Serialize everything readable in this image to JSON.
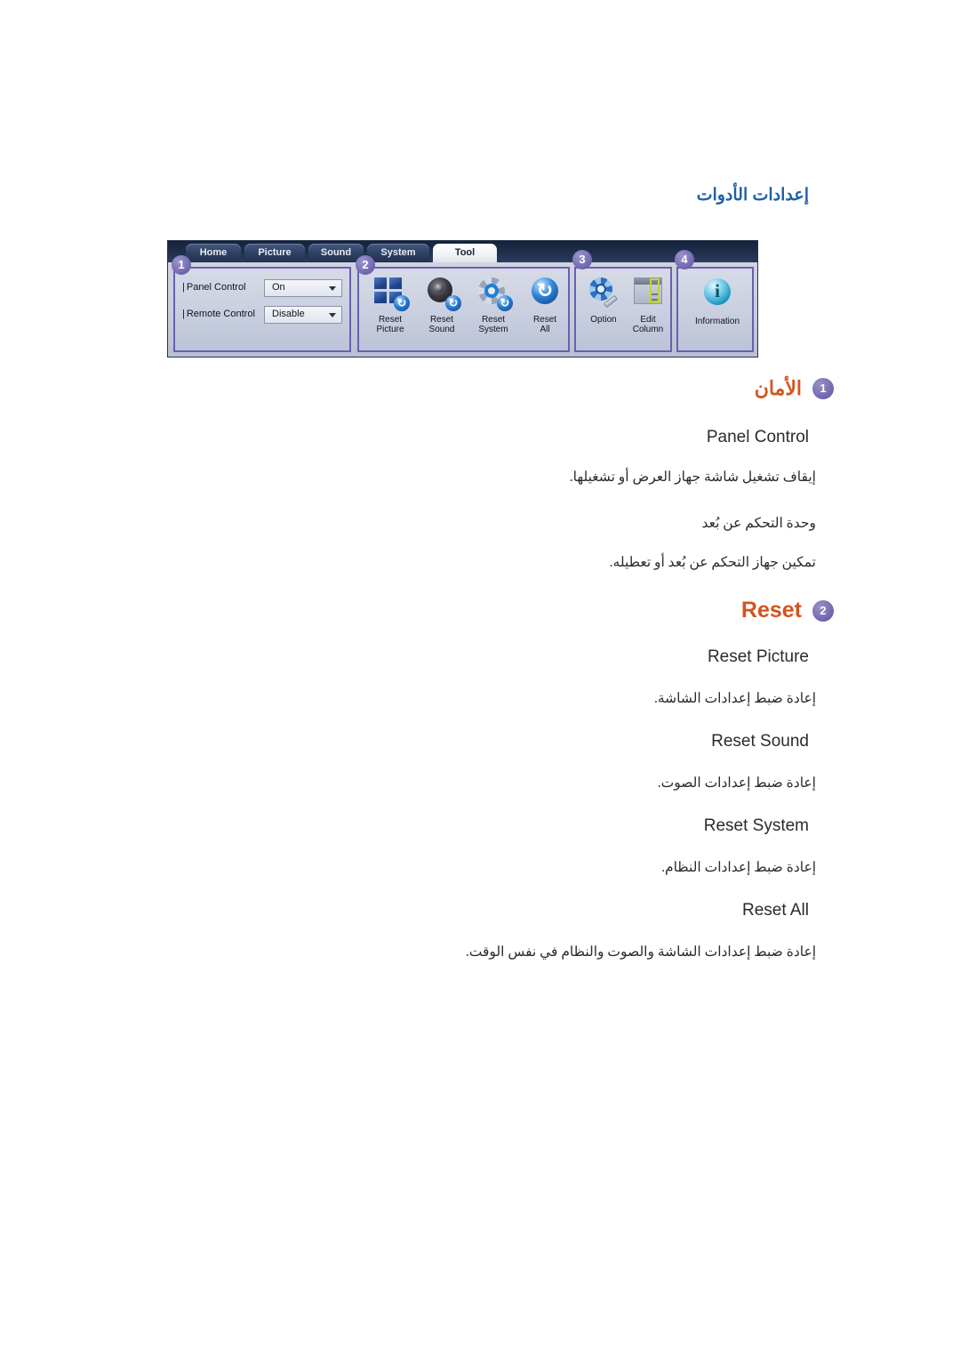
{
  "page": {
    "title": "إعدادات الأدوات"
  },
  "toolbar": {
    "tabs": [
      {
        "label": "Home",
        "active": false
      },
      {
        "label": "Picture",
        "active": false
      },
      {
        "label": "Sound",
        "active": false
      },
      {
        "label": "System",
        "active": false
      },
      {
        "label": "Tool",
        "active": true
      }
    ],
    "group1": {
      "badge": "1",
      "rows": [
        {
          "label": "Panel Control",
          "value": "On"
        },
        {
          "label": "Remote Control",
          "value": "Disable"
        }
      ]
    },
    "group2": {
      "badge": "2",
      "icons": [
        {
          "caption_line1": "Reset",
          "caption_line2": "Picture"
        },
        {
          "caption_line1": "Reset",
          "caption_line2": "Sound"
        },
        {
          "caption_line1": "Reset",
          "caption_line2": "System"
        },
        {
          "caption_line1": "Reset",
          "caption_line2": "All"
        }
      ]
    },
    "group3": {
      "badge": "3",
      "icons": [
        {
          "caption_line1": "Option",
          "caption_line2": ""
        },
        {
          "caption_line1": "Edit",
          "caption_line2": "Column"
        }
      ]
    },
    "group4": {
      "badge": "4",
      "icons": [
        {
          "caption_line1": "Information",
          "caption_line2": ""
        }
      ]
    }
  },
  "sections": [
    {
      "badge": "1",
      "heading": "الأمان",
      "items": [
        {
          "name": "Panel Control",
          "description": "إيقاف تشغيل شاشة جهاز العرض أو تشغيلها."
        },
        {
          "name": "وحدة التحكم عن بُعد",
          "description": "تمكين جهاز التحكم عن بُعد أو تعطيله."
        }
      ]
    },
    {
      "badge": "2",
      "heading": "Reset",
      "items": [
        {
          "name": "Reset Picture",
          "description": "إعادة ضبط إعدادات الشاشة."
        },
        {
          "name": "Reset Sound",
          "description": "إعادة ضبط إعدادات الصوت."
        },
        {
          "name": "Reset System",
          "description": "إعادة ضبط إعدادات النظام."
        },
        {
          "name": "Reset All",
          "description": "إعادة ضبط إعدادات الشاشة والصوت والنظام في نفس الوقت."
        }
      ]
    }
  ],
  "colors": {
    "title_blue": "#1f5fa9",
    "heading_orange": "#d4541e",
    "badge_purple": "#6f65ad",
    "group_border": "#6b5fae"
  }
}
